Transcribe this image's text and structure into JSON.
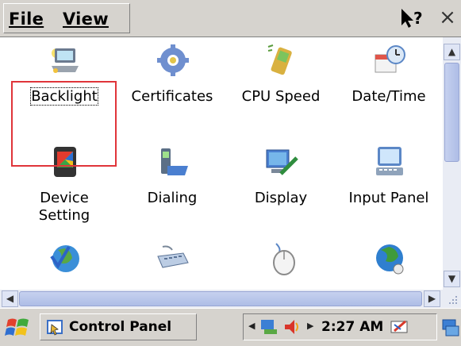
{
  "menubar": {
    "file_label": "File",
    "view_label": "View",
    "help_icon": "whats-this-help-icon",
    "close_label": "×"
  },
  "items": [
    {
      "label": "Backlight",
      "icon": "backlight-laptop-icon",
      "selected": true
    },
    {
      "label": "Certificates",
      "icon": "gear-certificate-icon"
    },
    {
      "label": "CPU Speed",
      "icon": "cpu-speed-gauge-icon"
    },
    {
      "label": "Date/Time",
      "icon": "date-time-calendar-icon"
    },
    {
      "label": "Device Setting",
      "icon": "device-setting-icon"
    },
    {
      "label": "Dialing",
      "icon": "dialing-phone-icon"
    },
    {
      "label": "Display",
      "icon": "display-monitor-icon"
    },
    {
      "label": "Input Panel",
      "icon": "input-panel-icon"
    },
    {
      "label": "",
      "icon": "globe-check-icon"
    },
    {
      "label": "",
      "icon": "keyboard-icon"
    },
    {
      "label": "",
      "icon": "mouse-icon"
    },
    {
      "label": "",
      "icon": "network-globe-icon"
    }
  ],
  "scrollbars": {
    "up_arrow": "▲",
    "down_arrow": "▼",
    "left_arrow": "◀",
    "right_arrow": "▶"
  },
  "taskbar": {
    "start_icon": "windows-start-icon",
    "task_label": "Control Panel",
    "clock": "2:27 AM",
    "tray_icons": [
      "network-icon",
      "volume-icon",
      "input-method-icon",
      "desktop-icon"
    ]
  },
  "colors": {
    "selection_border": "#e0353a",
    "chrome": "#d6d3ce",
    "scrollbar_track": "#e9ecf4"
  }
}
